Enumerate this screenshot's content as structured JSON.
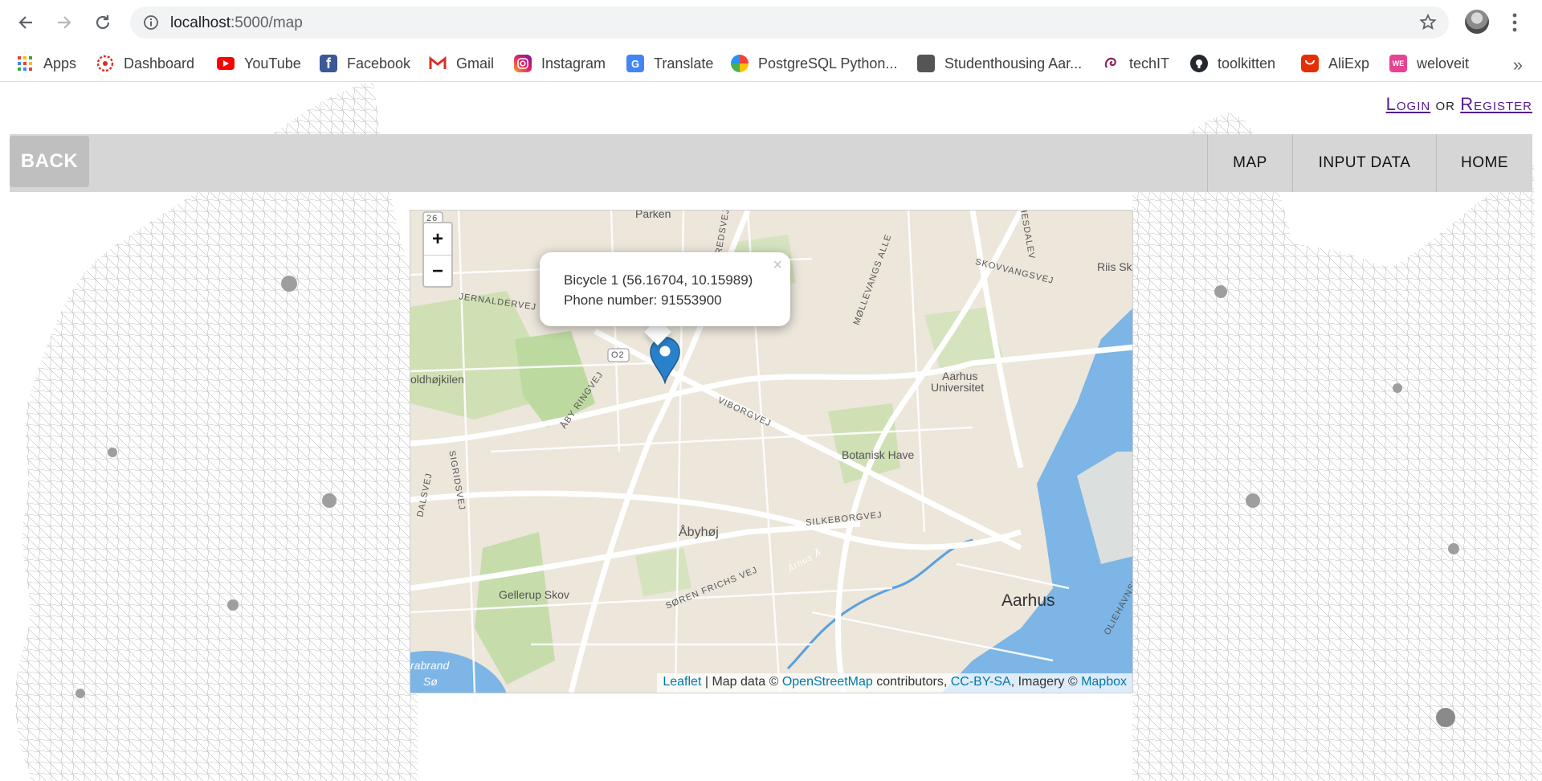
{
  "browser": {
    "url_host": "localhost",
    "url_path": ":5000/map",
    "bookmarks": [
      {
        "label": "Apps",
        "icon": "apps-grid-icon"
      },
      {
        "label": "Dashboard",
        "icon": "dashboard-icon"
      },
      {
        "label": "YouTube",
        "icon": "youtube-icon"
      },
      {
        "label": "Facebook",
        "icon": "facebook-icon"
      },
      {
        "label": "Gmail",
        "icon": "gmail-icon"
      },
      {
        "label": "Instagram",
        "icon": "instagram-icon"
      },
      {
        "label": "Translate",
        "icon": "translate-icon"
      },
      {
        "label": "PostgreSQL Python...",
        "icon": "postgresql-icon"
      },
      {
        "label": "Studenthousing Aar...",
        "icon": "page-icon"
      },
      {
        "label": "techIT",
        "icon": "techit-icon"
      },
      {
        "label": "toolkitten",
        "icon": "github-icon"
      },
      {
        "label": "AliExp",
        "icon": "aliexpress-icon"
      },
      {
        "label": "weloveit",
        "icon": "weloveit-icon"
      }
    ],
    "more": "»"
  },
  "auth": {
    "login": "Login",
    "or": "or",
    "register": "Register"
  },
  "nav": {
    "back": "BACK",
    "items": [
      "MAP",
      "INPUT DATA",
      "HOME"
    ]
  },
  "map": {
    "zoom_in": "+",
    "zoom_out": "−",
    "popup": {
      "line1": "Bicycle 1 (56.16704, 10.15989)",
      "line2": "Phone number: 91553900",
      "close": "×"
    },
    "labels": {
      "parken": "Parken",
      "riis": "Riis Sk",
      "oldhojkilen": "oldhøjkilen",
      "aarhus_uni": "Aarhus",
      "aarhus_uni2": "Universitet",
      "botanisk": "Botanisk Have",
      "abyhoj": "Åbyhøj",
      "gellerup": "Gellerup Skov",
      "aarhus": "Aarhus",
      "brabrand": "rabrand",
      "brabrand2": "Sø",
      "o2": "O2",
      "r26": "26"
    },
    "streets": {
      "jernaldervej": "JERNALDERVEJ",
      "aby_ringvej": "ÅBY RINGVEJ",
      "viborgvej": "VIBORGVEJ",
      "silkeborgvej": "SILKEBORGVEJ",
      "soren_frichs": "SØREN FRICHS VEJ",
      "mollevangs": "MØLLEVANGS ALLE",
      "skovvangsvej": "SKOVVANGSVEJ",
      "sigridsvej": "SIGRIDSVEJ",
      "dalsvej": "DALSVEJ",
      "oliehavnsvej": "OLIEHAVNSVEJ",
      "aarhus_a": "Århus Å",
      "redsvej": "REDSVEJ",
      "thesdalev": "THESDALEV"
    },
    "attribution": {
      "leaflet": "Leaflet",
      "sep": " | Map data © ",
      "osm": "OpenStreetMap",
      "contrib": " contributors, ",
      "cc": "CC-BY-SA",
      "imagery": ", Imagery © ",
      "mapbox": "Mapbox"
    }
  }
}
